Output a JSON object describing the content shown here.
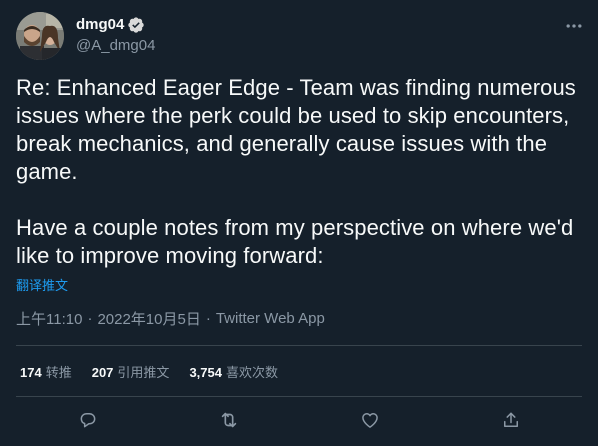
{
  "author": {
    "display_name": "dmg04",
    "handle": "@A_dmg04",
    "verified": true
  },
  "tweet": {
    "text": "Re: Enhanced Eager Edge - Team was finding numerous issues where the perk could be used to skip encounters, break mechanics, and generally cause issues with the game.\n\nHave a couple notes from my perspective on where we'd like to improve moving forward:",
    "translate_label": "翻译推文",
    "time": "上午11:10",
    "separator": "·",
    "date": "2022年10月5日",
    "source": "Twitter Web App"
  },
  "stats": {
    "retweets": {
      "count": "174",
      "label": "转推"
    },
    "quotes": {
      "count": "207",
      "label": "引用推文"
    },
    "likes": {
      "count": "3,754",
      "label": "喜欢次数"
    }
  },
  "icons": {
    "verified": "verified-badge-icon",
    "more": "more-options-icon",
    "reply": "reply-icon",
    "retweet": "retweet-icon",
    "like": "like-heart-icon",
    "share": "share-icon"
  },
  "colors": {
    "background": "#15202b",
    "text": "#f7f9f9",
    "secondary": "#8b98a5",
    "accent": "#1d9bf0",
    "divider": "#38444d"
  }
}
